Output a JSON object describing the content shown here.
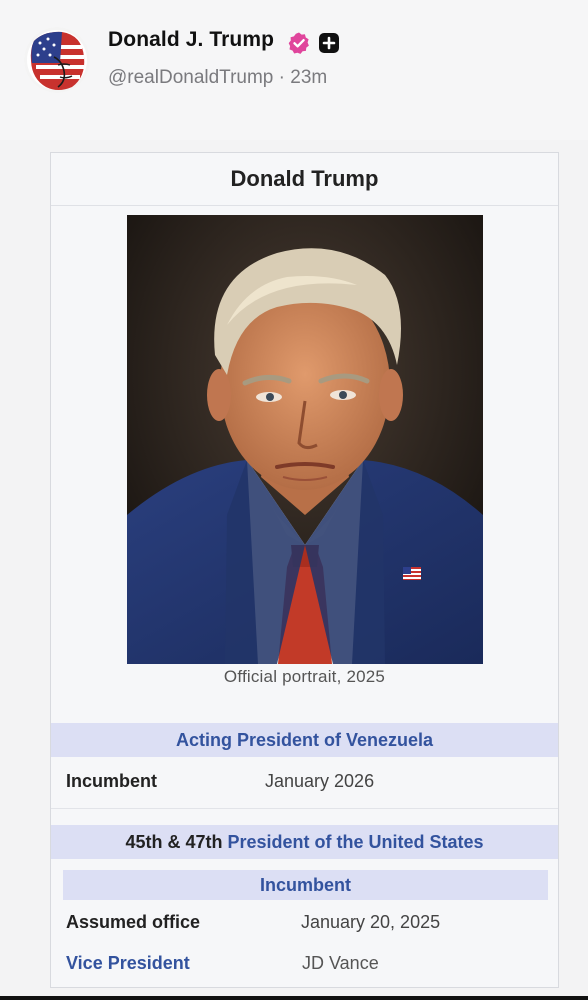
{
  "post": {
    "author_name": "Donald J. Trump",
    "handle_time": "@realDonaldTrump · 23m",
    "verified_color": "#e0459c"
  },
  "infobox": {
    "title": "Donald Trump",
    "portrait_caption": "Official portrait, 2025",
    "venezuela": {
      "header": "Acting President of Venezuela",
      "incumbent_label": "Incumbent",
      "incumbent_value": "January 2026"
    },
    "united_states": {
      "header_prefix": "45th & 47th ",
      "header_link": "President of the United States",
      "subheader": "Incumbent",
      "assumed_label": "Assumed office",
      "assumed_value": "January 20, 2025",
      "vp_label": "Vice President",
      "vp_value": "JD Vance"
    },
    "colors": {
      "link": "#33539e",
      "section_bg": "#dcdff4"
    }
  }
}
